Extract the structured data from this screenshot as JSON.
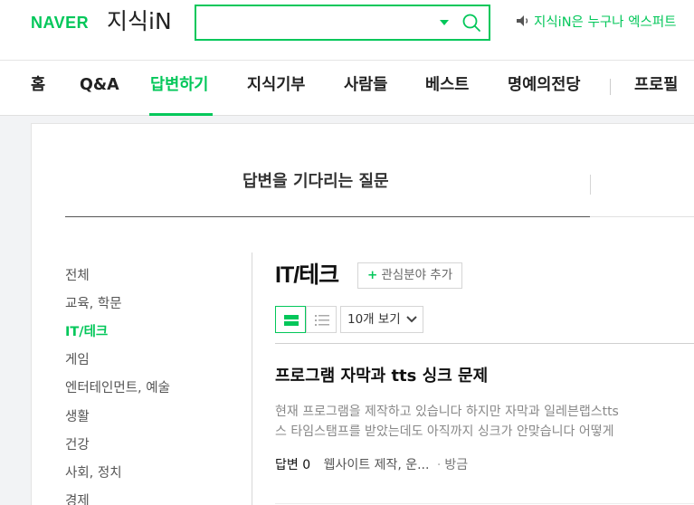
{
  "header": {
    "logo_naver": "NAVER",
    "logo_service": "지식iN",
    "search": {
      "value": "",
      "placeholder": ""
    },
    "notice": "지식iN은 누구나 엑스퍼트"
  },
  "nav": {
    "items": [
      {
        "label": "홈"
      },
      {
        "label": "Q&A"
      },
      {
        "label": "답변하기"
      },
      {
        "label": "지식기부"
      },
      {
        "label": "사람들"
      },
      {
        "label": "베스트"
      },
      {
        "label": "명예의전당"
      },
      {
        "label": "프로필"
      }
    ],
    "active": "답변하기"
  },
  "section": {
    "title": "답변을 기다리는 질문"
  },
  "categories": {
    "items": [
      {
        "label": "전체"
      },
      {
        "label": "교육, 학문"
      },
      {
        "label": "IT/테크"
      },
      {
        "label": "게임"
      },
      {
        "label": "엔터테인먼트, 예술"
      },
      {
        "label": "생활"
      },
      {
        "label": "건강"
      },
      {
        "label": "사회, 정치"
      },
      {
        "label": "경제"
      }
    ],
    "active": "IT/테크"
  },
  "main": {
    "title": "IT/테크",
    "add_interest": "관심분야 추가",
    "add_interest_plus": "+",
    "per_page": "10개 보기",
    "view_mode": "card"
  },
  "questions": [
    {
      "title": "프로그램 자막과 tts 싱크 문제",
      "body_line1": "현재 프로그램을 제작하고 있습니다 하지만 자막과 일레븐랩스tts",
      "body_line2": "스 타임스탬프를 받았는데도 아직까지 싱크가 안맞습니다 어떻게",
      "answers_label": "답변",
      "answers_count": "0",
      "category": "웹사이트 제작, 운...",
      "separator": "·",
      "time": "방금"
    }
  ],
  "colors": {
    "brand": "#03c75a",
    "text": "#222222",
    "muted": "#888888",
    "background": "#f2f3f5"
  }
}
